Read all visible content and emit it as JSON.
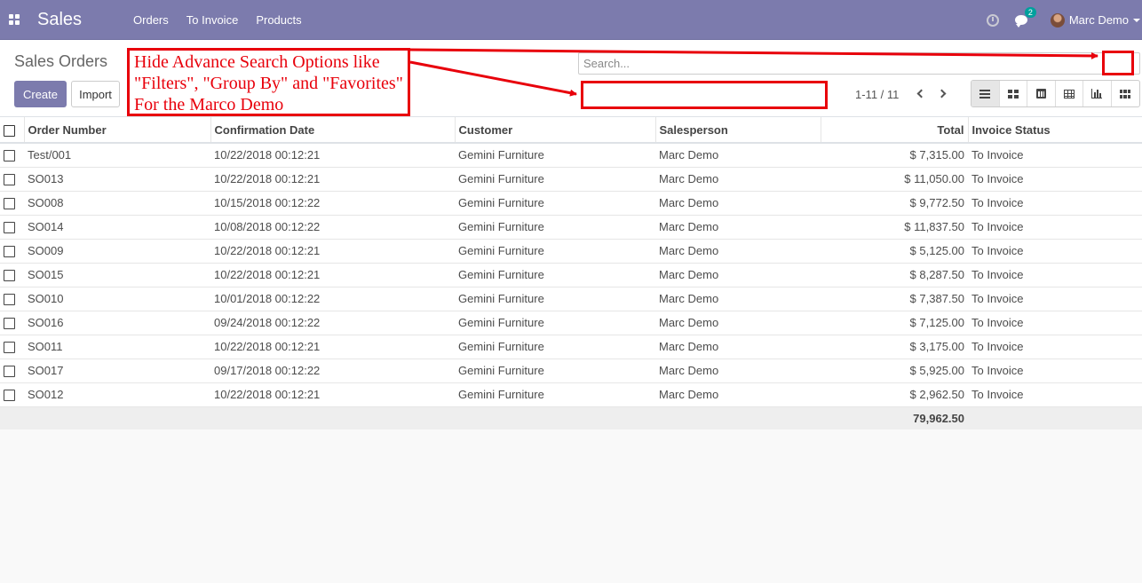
{
  "navbar": {
    "app_name": "Sales",
    "menu": [
      "Orders",
      "To Invoice",
      "Products"
    ],
    "messages_count": "2",
    "user_name": "Marc Demo"
  },
  "control_panel": {
    "title": "Sales Orders",
    "create_label": "Create",
    "import_label": "Import",
    "search_placeholder": "Search...",
    "pager": "1-11 / 11",
    "views": [
      "list",
      "kanban",
      "calendar",
      "pivot",
      "graph",
      "grid"
    ],
    "active_view": "list"
  },
  "table": {
    "columns": [
      "Order Number",
      "Confirmation Date",
      "Customer",
      "Salesperson",
      "Total",
      "Invoice Status"
    ],
    "rows": [
      {
        "number": "Test/001",
        "date": "10/22/2018 00:12:21",
        "customer": "Gemini Furniture",
        "salesperson": "Marc Demo",
        "total": "$ 7,315.00",
        "status": "To Invoice"
      },
      {
        "number": "SO013",
        "date": "10/22/2018 00:12:21",
        "customer": "Gemini Furniture",
        "salesperson": "Marc Demo",
        "total": "$ 11,050.00",
        "status": "To Invoice"
      },
      {
        "number": "SO008",
        "date": "10/15/2018 00:12:22",
        "customer": "Gemini Furniture",
        "salesperson": "Marc Demo",
        "total": "$ 9,772.50",
        "status": "To Invoice"
      },
      {
        "number": "SO014",
        "date": "10/08/2018 00:12:22",
        "customer": "Gemini Furniture",
        "salesperson": "Marc Demo",
        "total": "$ 11,837.50",
        "status": "To Invoice"
      },
      {
        "number": "SO009",
        "date": "10/22/2018 00:12:21",
        "customer": "Gemini Furniture",
        "salesperson": "Marc Demo",
        "total": "$ 5,125.00",
        "status": "To Invoice"
      },
      {
        "number": "SO015",
        "date": "10/22/2018 00:12:21",
        "customer": "Gemini Furniture",
        "salesperson": "Marc Demo",
        "total": "$ 8,287.50",
        "status": "To Invoice"
      },
      {
        "number": "SO010",
        "date": "10/01/2018 00:12:22",
        "customer": "Gemini Furniture",
        "salesperson": "Marc Demo",
        "total": "$ 7,387.50",
        "status": "To Invoice"
      },
      {
        "number": "SO016",
        "date": "09/24/2018 00:12:22",
        "customer": "Gemini Furniture",
        "salesperson": "Marc Demo",
        "total": "$ 7,125.00",
        "status": "To Invoice"
      },
      {
        "number": "SO011",
        "date": "10/22/2018 00:12:21",
        "customer": "Gemini Furniture",
        "salesperson": "Marc Demo",
        "total": "$ 3,175.00",
        "status": "To Invoice"
      },
      {
        "number": "SO017",
        "date": "09/17/2018 00:12:22",
        "customer": "Gemini Furniture",
        "salesperson": "Marc Demo",
        "total": "$ 5,925.00",
        "status": "To Invoice"
      },
      {
        "number": "SO012",
        "date": "10/22/2018 00:12:21",
        "customer": "Gemini Furniture",
        "salesperson": "Marc Demo",
        "total": "$ 2,962.50",
        "status": "To Invoice"
      }
    ],
    "grand_total": "79,962.50"
  },
  "annotation": {
    "lines": [
      "Hide Advance Search Options like",
      "\"Filters\", \"Group By\" and \"Favorites\"",
      "For the Marco Demo"
    ],
    "color": "#e8000b"
  },
  "colors": {
    "brand": "#7c7bad",
    "accent_badge": "#00a09d"
  }
}
